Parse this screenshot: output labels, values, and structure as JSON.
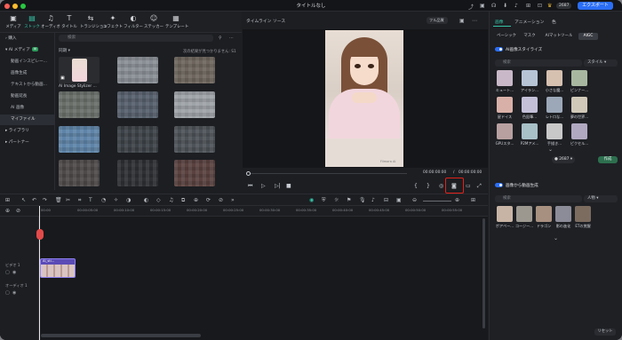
{
  "window": {
    "title": "タイトルなし",
    "export_label": "エクスポート",
    "credits": "2687"
  },
  "media_tabs": [
    {
      "label": "メディア",
      "icon": "media-icon",
      "glyph": "▣"
    },
    {
      "label": "ストック",
      "icon": "stock-icon",
      "glyph": "▤"
    },
    {
      "label": "オーディオ",
      "icon": "audio-icon",
      "glyph": "♫"
    },
    {
      "label": "タイトル",
      "icon": "title-icon",
      "glyph": "T"
    },
    {
      "label": "トランジション",
      "icon": "transition-icon",
      "glyph": "⇆"
    },
    {
      "label": "エフェクト",
      "icon": "effect-icon",
      "glyph": "✦"
    },
    {
      "label": "フィルター",
      "icon": "filter-icon",
      "glyph": "◐"
    },
    {
      "label": "ステッカー",
      "icon": "sticker-icon",
      "glyph": "☺"
    },
    {
      "label": "テンプレート",
      "icon": "template-icon",
      "glyph": "▦"
    }
  ],
  "library": {
    "items": [
      {
        "label": "購入"
      },
      {
        "label": "AI メディア"
      },
      {
        "label": "動画インスピレー..."
      },
      {
        "label": "画像生成"
      },
      {
        "label": "テキストから動画..."
      },
      {
        "label": "動画延長"
      },
      {
        "label": "AI 画像"
      },
      {
        "label": "マイファイル"
      },
      {
        "label": "ライブラリ"
      },
      {
        "label": "パートナー"
      }
    ],
    "ai_badge": "AI"
  },
  "grid": {
    "search_placeholder": "検索",
    "sort_label": "同期",
    "hint": "次の結果が見つかりません: S1",
    "first_caption": "AI Image Stylizer ..."
  },
  "preview": {
    "tab_timeline": "タイムライン",
    "tab_source": "ソース",
    "quality": "フル品質",
    "current_time": "00:00:00:00",
    "total_time": "00:00:00:00",
    "separator": "/",
    "watermark": "Filmora AI"
  },
  "right_panel": {
    "tabs": [
      "画像",
      "アニメーション",
      "色"
    ],
    "subtabs": [
      "ベーシック",
      "マスク",
      "AIマットツール",
      "AIGC"
    ],
    "ai_stylizer_title": "AI画像スタイライズ",
    "search_placeholder": "検索",
    "style_select": "スタイル",
    "styles_row1": [
      "キュート...",
      "アイラン...",
      "小さな魔...",
      "ピンナー..."
    ],
    "styles_row2": [
      "星ドイス",
      "色鉛筆...",
      "レトロな...",
      "夢の世界..."
    ],
    "styles_row3": [
      "GPUスタ...",
      "P2Mアメ...",
      "手描き...",
      "ピクセル..."
    ],
    "credit": "2687",
    "generate_label": "作成",
    "img2video_title": "画像から動画生成",
    "search2_placeholder": "検索",
    "people_select": "人物",
    "styles_row4": [
      "ポアペー...",
      "コージー...",
      "ドラゴン",
      "影の進化",
      "ETの覚醒"
    ],
    "reset_label": "リセット"
  },
  "timeline": {
    "ticks": [
      "00:00",
      "00:00:05:00",
      "00:00:10:00",
      "00:00:15:00",
      "00:00:20:00",
      "00:00:25:00",
      "00:00:30:00",
      "00:00:35:00",
      "00:00:40:00",
      "00:00:45:00",
      "00:00:50:00",
      "00:00:55:00"
    ],
    "video_track": "ビデオ 1",
    "audio_track": "オーディオ 1",
    "clip_label": "AI_sti..."
  },
  "colors": {
    "accent": "#35c4a6",
    "export": "#2b6ef6",
    "highlight": "#e0211b"
  }
}
